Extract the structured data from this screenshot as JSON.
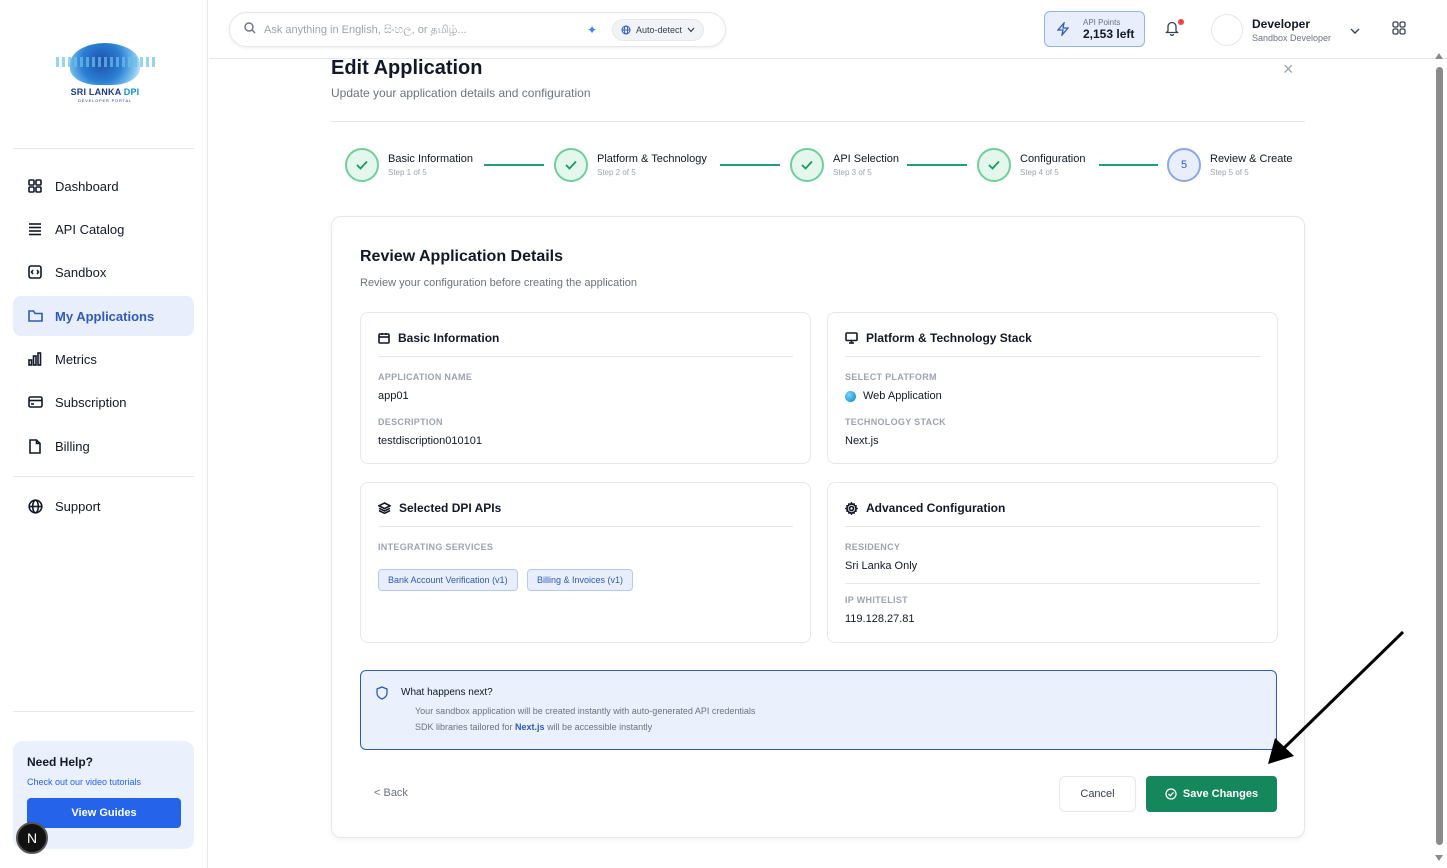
{
  "brand": {
    "logo_main": "SRI LANKA ",
    "logo_accent": "DPI",
    "logo_sub": "DEVELOPER PORTAL"
  },
  "sidebar": {
    "items": [
      {
        "label": "Dashboard",
        "icon": "dashboard-grid-icon"
      },
      {
        "label": "API Catalog",
        "icon": "list-icon"
      },
      {
        "label": "Sandbox",
        "icon": "code-icon"
      },
      {
        "label": "My Applications",
        "icon": "folder-icon",
        "active": true
      },
      {
        "label": "Metrics",
        "icon": "bar-chart-icon"
      },
      {
        "label": "Subscription",
        "icon": "credit-card-icon"
      },
      {
        "label": "Billing",
        "icon": "file-icon"
      },
      {
        "label": "Support",
        "icon": "globe-icon"
      }
    ],
    "help": {
      "title": "Need Help?",
      "link": "Check out our video tutorials",
      "button": "View Guides"
    },
    "badge": "N"
  },
  "topbar": {
    "search_placeholder": "Ask anything in English, සිංහල, or தமிழ்...",
    "language": "Auto-detect",
    "points_label": "API Points",
    "points_value": "2,153 left",
    "user_name": "Developer",
    "user_role": "Sandbox Developer"
  },
  "page": {
    "title": "Edit Application",
    "subtitle": "Update your application details and configuration",
    "close": "×"
  },
  "steps": [
    {
      "title": "Basic Information",
      "sub": "Step 1 of 5",
      "done": true
    },
    {
      "title": "Platform & Technology",
      "sub": "Step 2 of 5",
      "done": true
    },
    {
      "title": "API Selection",
      "sub": "Step 3 of 5",
      "done": true
    },
    {
      "title": "Configuration",
      "sub": "Step 4 of 5",
      "done": true
    },
    {
      "title": "Review & Create",
      "sub": "Step 5 of 5",
      "done": false,
      "number": "5"
    }
  ],
  "review": {
    "title": "Review Application Details",
    "subtitle": "Review your configuration before creating the application",
    "basic": {
      "heading": "Basic Information",
      "name_label": "APPLICATION NAME",
      "name_value": "app01",
      "desc_label": "DESCRIPTION",
      "desc_value": "testdiscription010101"
    },
    "platform": {
      "heading": "Platform & Technology Stack",
      "platform_label": "SELECT PLATFORM",
      "platform_value": "Web Application",
      "stack_label": "TECHNOLOGY STACK",
      "stack_value": "Next.js"
    },
    "apis": {
      "heading": "Selected DPI APIs",
      "label": "INTEGRATING SERVICES",
      "chips": [
        "Bank Account Verification (v1)",
        "Billing & Invoices (v1)"
      ]
    },
    "advanced": {
      "heading": "Advanced Configuration",
      "residency_label": "RESIDENCY",
      "residency_value": "Sri Lanka Only",
      "ip_label": "IP WHITELIST",
      "ip_value": "119.128.27.81"
    },
    "next": {
      "title": "What happens next?",
      "line1": "Your sandbox application will be created instantly with auto-generated API credentials",
      "line2_pre": "SDK libraries tailored for ",
      "line2_bold": "Next.js",
      "line2_post": " will be accessible instantly"
    }
  },
  "actions": {
    "back": "< Back",
    "cancel": "Cancel",
    "save": "Save Changes"
  },
  "colors": {
    "primary": "#2563eb",
    "success": "#15875c",
    "accent_soft": "#e8eefb"
  }
}
